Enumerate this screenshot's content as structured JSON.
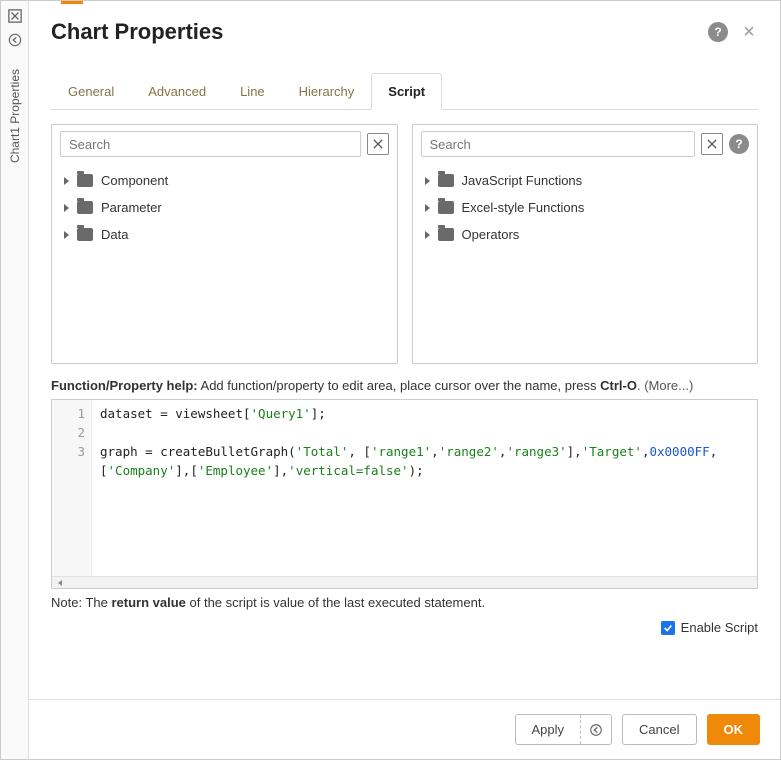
{
  "sidebar": {
    "panel_label": "Chart1 Properties"
  },
  "dialog": {
    "title": "Chart Properties"
  },
  "tabs": [
    {
      "id": "general",
      "label": "General",
      "active": false
    },
    {
      "id": "advanced",
      "label": "Advanced",
      "active": false
    },
    {
      "id": "line",
      "label": "Line",
      "active": false
    },
    {
      "id": "hierarchy",
      "label": "Hierarchy",
      "active": false
    },
    {
      "id": "script",
      "label": "Script",
      "active": true
    }
  ],
  "left_tree": {
    "search_placeholder": "Search",
    "items": [
      "Component",
      "Parameter",
      "Data"
    ]
  },
  "right_tree": {
    "search_placeholder": "Search",
    "items": [
      "JavaScript Functions",
      "Excel-style Functions",
      "Operators"
    ]
  },
  "help_line": {
    "prefix": "Function/Property help:",
    "body": " Add function/property to edit area, place cursor over the name, press ",
    "shortcut": "Ctrl-O",
    "more": ". (More...)"
  },
  "code": {
    "line_numbers": [
      "1",
      "2",
      "3"
    ],
    "l1_a": "dataset = viewsheet[",
    "l1_s": "'Query1'",
    "l1_b": "];",
    "l3_a": "graph = createBulletGraph(",
    "l3_s1": "'Total'",
    "l3_b": ", [",
    "l3_s2": "'range1'",
    "l3_c": ",",
    "l3_s3": "'range2'",
    "l3_d": ",",
    "l3_s4": "'range3'",
    "l3_e": "],",
    "l3_s5": "'Target'",
    "l3_f": ",",
    "l3_n": "0x0000FF",
    "l3_g": ",[",
    "l3_s6": "'Company'",
    "l3_h": "],[",
    "l3_s7": "'Employee'",
    "l3_i": "],",
    "l3_s8": "'vertical=false'",
    "l3_j": ");"
  },
  "note": {
    "prefix": "Note: The ",
    "bold": "return value",
    "suffix": " of the script is value of the last executed statement."
  },
  "enable_script": {
    "label": "Enable Script",
    "checked": true
  },
  "buttons": {
    "apply": "Apply",
    "cancel": "Cancel",
    "ok": "OK"
  }
}
